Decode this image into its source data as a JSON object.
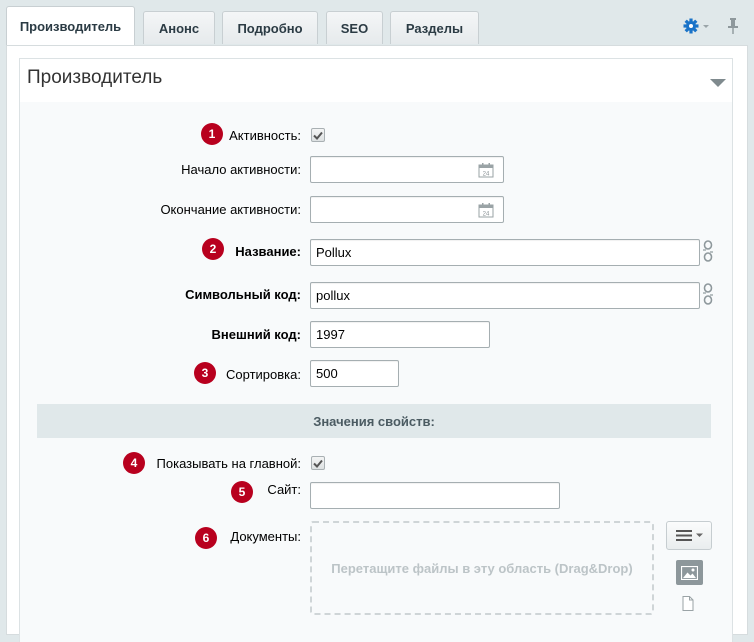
{
  "tabs": [
    {
      "label": "Производитель",
      "active": true
    },
    {
      "label": "Анонс"
    },
    {
      "label": "Подробно"
    },
    {
      "label": "SEO"
    },
    {
      "label": "Разделы"
    }
  ],
  "toolbar": {
    "settings_icon": "gear-icon",
    "pin_icon": "pin-icon"
  },
  "section": {
    "title": "Производитель"
  },
  "form": {
    "active": {
      "label": "Активность:",
      "checked": true,
      "badge": "1"
    },
    "active_from": {
      "label": "Начало активности:",
      "value": ""
    },
    "active_to": {
      "label": "Окончание активности:",
      "value": ""
    },
    "name": {
      "label": "Название:",
      "value": "Pollux",
      "badge": "2"
    },
    "code": {
      "label": "Символьный код:",
      "value": "pollux"
    },
    "xml_id": {
      "label": "Внешний код:",
      "value": "1997"
    },
    "sort": {
      "label": "Сортировка:",
      "value": "500",
      "badge": "3"
    }
  },
  "properties": {
    "heading": "Значения свойств:",
    "show_on_main": {
      "label": "Показывать на главной:",
      "checked": true,
      "badge": "4"
    },
    "site": {
      "label": "Сайт:",
      "value": "",
      "badge": "5"
    },
    "documents": {
      "label": "Документы:",
      "badge": "6",
      "dropzone_text": "Перетащите файлы в эту область (Drag&Drop)"
    }
  },
  "colors": {
    "badge": "#b8001e",
    "background": "#e0e8ea",
    "group_bar": "#e0e8ea"
  }
}
